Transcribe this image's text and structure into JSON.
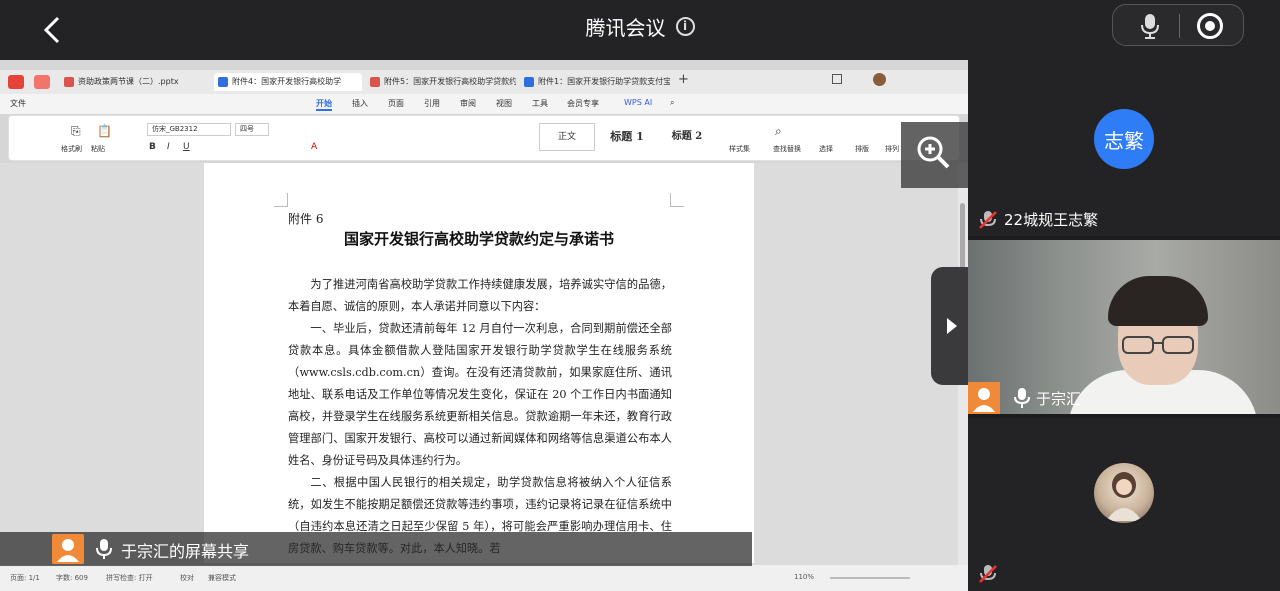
{
  "meeting": {
    "title": "腾讯会议",
    "share_label": "于宗汇的屏幕共享"
  },
  "wps": {
    "tabs": [
      {
        "label": "资助政策两节课（二）.pptx",
        "color": "#d9534f"
      },
      {
        "label": "附件4：国家开发银行高校助学",
        "color": "#2f6fe0"
      },
      {
        "label": "附件5：国家开发银行高校助学贷款约",
        "color": "#d9534f"
      },
      {
        "label": "附件1：国家开发银行助学贷款支付宝",
        "color": "#2f6fe0"
      }
    ],
    "menu": {
      "file": "文件",
      "items": [
        "开始",
        "插入",
        "页面",
        "引用",
        "审阅",
        "视图",
        "工具",
        "会员专享"
      ],
      "ai": "WPS AI"
    },
    "ribbon": {
      "format_painter": "格式刷",
      "paste": "粘贴",
      "font_name": "仿宋_GB2312",
      "font_size": "四号",
      "styles": [
        "正文",
        "标题 1",
        "标题 2"
      ],
      "style_set": "样式集",
      "find_replace": "查找替换",
      "select": "选择",
      "sort": "排版",
      "arrange": "排列"
    },
    "statusbar": {
      "page": "页面: 1/1",
      "words": "字数: 609",
      "spell": "拼写检查: 打开",
      "proof": "校对",
      "compat": "兼容模式",
      "zoom": "110%"
    }
  },
  "document": {
    "attachment": "附件 6",
    "title": "国家开发银行高校助学贷款约定与承诺书",
    "paragraphs": [
      "为了推进河南省高校助学贷款工作持续健康发展，培养诚实守信的品德，本着自愿、诚信的原则，本人承诺并同意以下内容：",
      "一、毕业后，贷款还清前每年 12 月自付一次利息，合同到期前偿还全部贷款本息。具体金额借款人登陆国家开发银行助学贷款学生在线服务系统（www.csls.cdb.com.cn）查询。在没有还清贷款前，如果家庭住所、通讯地址、联系电话及工作单位等情况发生变化，保证在 20 个工作日内书面通知高校，并登录学生在线服务系统更新相关信息。贷款逾期一年未还，教育行政管理部门、国家开发银行、高校可以通过新闻媒体和网络等信息渠道公布本人姓名、身份证号码及具体违约行为。",
      "二、根据中国人民银行的相关规定，助学贷款信息将被纳入个人征信系统，如发生不能按期足额偿还贷款等违约事项，违约记录将记录在征信系统中（自违约本息还清之日起至少保留 5 年），将可能会严重影响办理信用卡、住房贷款、购车贷款等。对此，本人知晓。若"
    ]
  },
  "participants": [
    {
      "name": "22城规王志繁",
      "avatar_text": "志繁",
      "avatar_color": "#2f7df6",
      "muted": true
    },
    {
      "name": "于宗汇",
      "muted": false,
      "video": true
    },
    {
      "name": "",
      "muted": true,
      "avatar": "photo"
    }
  ]
}
